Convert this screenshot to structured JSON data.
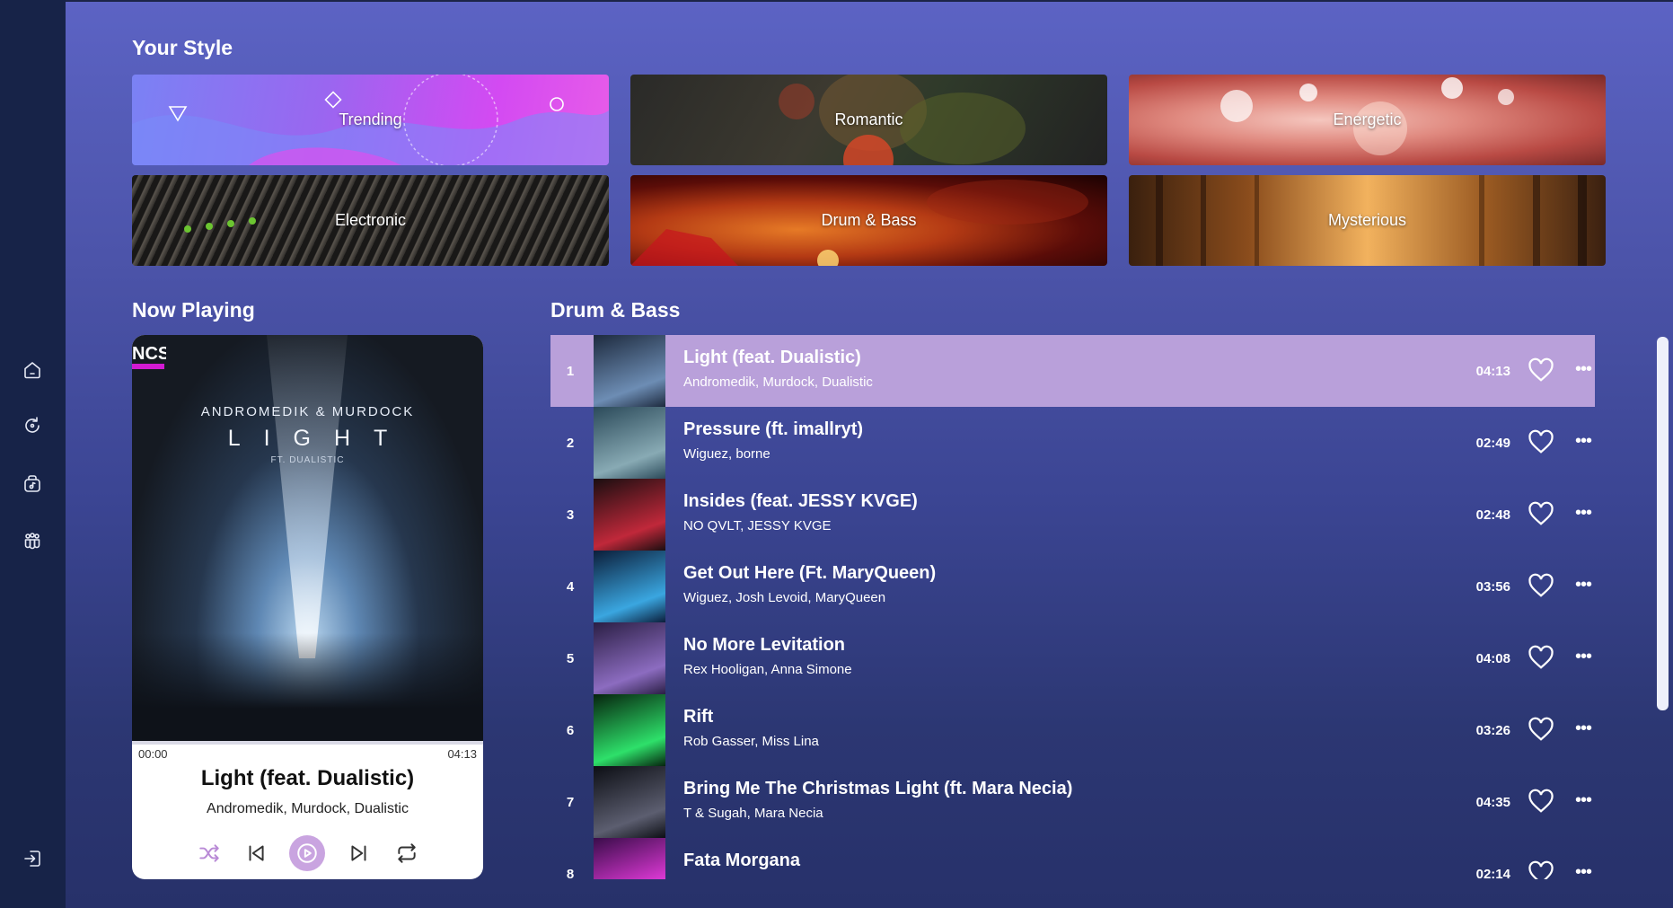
{
  "sidebar": {
    "icons": [
      "home-icon",
      "refresh-icon",
      "music-library-icon",
      "community-icon",
      "logout-icon"
    ]
  },
  "style_section": {
    "title": "Your Style",
    "cards": [
      {
        "label": "Trending",
        "colors": [
          "#7a6cf0",
          "#d34af2"
        ]
      },
      {
        "label": "Romantic",
        "colors": [
          "#2a2a26",
          "#4f4a2e"
        ]
      },
      {
        "label": "Energetic",
        "colors": [
          "#c85a52",
          "#f0b0a6"
        ]
      },
      {
        "label": "Electronic",
        "colors": [
          "#2c2a28",
          "#5c5650"
        ]
      },
      {
        "label": "Drum & Bass",
        "colors": [
          "#3a0606",
          "#d4541a"
        ]
      },
      {
        "label": "Mysterious",
        "colors": [
          "#5a3212",
          "#e09a4a"
        ]
      }
    ]
  },
  "now_playing": {
    "section_title": "Now Playing",
    "cover": {
      "badge": "NCS",
      "artist_line": "ANDROMEDIK & MURDOCK",
      "title_line": "LIGHT",
      "ft_line": "FT. DUALISTIC"
    },
    "time_current": "00:00",
    "time_total": "04:13",
    "progress": 0,
    "title": "Light (feat. Dualistic)",
    "artists": "Andromedik, Murdock, Dualistic",
    "controls": [
      "shuffle-icon",
      "previous-icon",
      "play-icon",
      "next-icon",
      "repeat-icon"
    ],
    "accent": "#c9a4e0"
  },
  "playlist": {
    "title": "Drum & Bass",
    "active_index": 0,
    "active_color": "#b9a0da",
    "tracks": [
      {
        "num": "1",
        "title": "Light (feat. Dualistic)",
        "artists": "Andromedik, Murdock, Dualistic",
        "duration": "04:13",
        "art": [
          "#1d2a3e",
          "#6d8db4"
        ]
      },
      {
        "num": "2",
        "title": "Pressure (ft. imallryt)",
        "artists": "Wiguez, borne",
        "duration": "02:49",
        "art": [
          "#2b4a5a",
          "#88aab4"
        ]
      },
      {
        "num": "3",
        "title": "Insides (feat. JESSY KVGE)",
        "artists": "NO QVLT, JESSY KVGE",
        "duration": "02:48",
        "art": [
          "#1a0e10",
          "#c0283a"
        ]
      },
      {
        "num": "4",
        "title": "Get Out Here (Ft. MaryQueen)",
        "artists": "Wiguez, Josh Levoid, MaryQueen",
        "duration": "03:56",
        "art": [
          "#0b1e3a",
          "#3aa6e0"
        ]
      },
      {
        "num": "5",
        "title": "No More Levitation",
        "artists": "Rex Hooligan, Anna Simone",
        "duration": "04:08",
        "art": [
          "#2a1e44",
          "#8c6cc0"
        ]
      },
      {
        "num": "6",
        "title": "Rift",
        "artists": "Rob Gasser, Miss Lina",
        "duration": "03:26",
        "art": [
          "#06240e",
          "#2ee06a"
        ]
      },
      {
        "num": "7",
        "title": "Bring Me The Christmas Light (ft. Mara Necia)",
        "artists": "T & Sugah, Mara Necia",
        "duration": "04:35",
        "art": [
          "#0c0e14",
          "#5c5e70"
        ]
      },
      {
        "num": "8",
        "title": "Fata Morgana",
        "artists": "",
        "duration": "02:14",
        "art": [
          "#3a0c4a",
          "#e03ad8"
        ]
      }
    ]
  }
}
